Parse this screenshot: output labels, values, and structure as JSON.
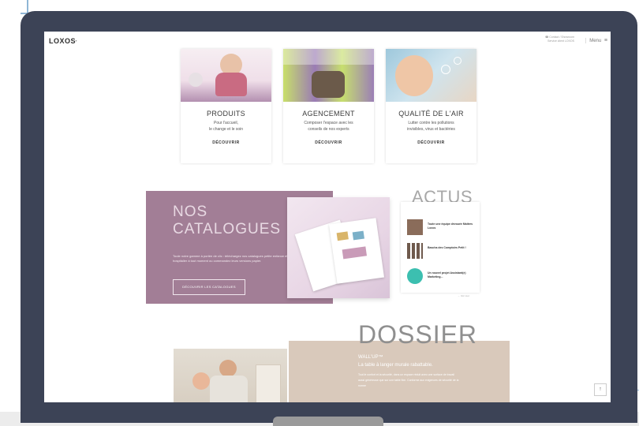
{
  "header": {
    "logo": "LOXOS",
    "lang": "fr ▾",
    "contact_line1": "☎ Contact / Showroom",
    "contact_line2": "Service client LOXOS",
    "menu_label": "Menu",
    "menu_icon": "≡"
  },
  "cards": [
    {
      "title": "PRODUITS",
      "desc_line1": "Pour l'accueil,",
      "desc_line2": "le change et le soin",
      "cta": "DÉCOUVRIR"
    },
    {
      "title": "AGENCEMENT",
      "desc_line1": "Composer l'espace avec les",
      "desc_line2": "conseils de nos experts",
      "cta": "DÉCOUVRIR"
    },
    {
      "title": "QUALITÉ DE L'AIR",
      "desc_line1": "Lutter contre les pollutions",
      "desc_line2": "invisibles, virus et bactéries",
      "cta": "DÉCOUVRIR"
    }
  ],
  "catalogues": {
    "title_line1": "NOS",
    "title_line2": "CATALOGUES",
    "text": "Toute notre gamme à portée de clic : téléchargez nos catalogues petite enfance et hospitalier à tout moment ou commandez leurs versions papier.",
    "button": "DÉCOUVRIR LES CATALOGUES"
  },
  "actus": {
    "title": "ACTUS",
    "items": [
      {
        "text": "Toute une équipe dévouée Maîtres Loxos"
      },
      {
        "text": "Bascha des Comptoirs Petit !"
      },
      {
        "text": "Un nouvel projet Assistant(e) Marketing..."
      }
    ],
    "see_all": "→ Voir tout"
  },
  "dossier": {
    "title": "DOSSIER",
    "product": "WALL'UP™",
    "subtitle": "La table à langer murale rabattable.",
    "text": "Tout le confort et la sécurité, dans un espace réduit avec une surface de travail aussi généreuse que sur une table fixe. Conforme aux exigences de sécurité de la norme"
  },
  "scroll_top": "↑"
}
